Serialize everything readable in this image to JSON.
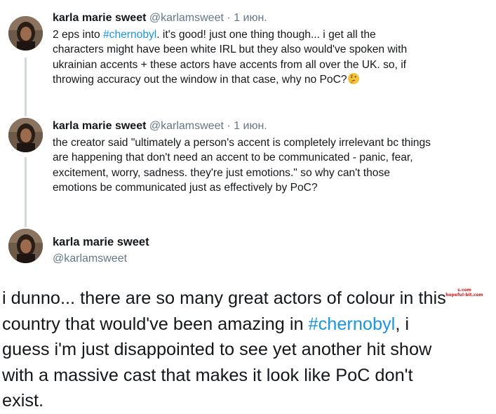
{
  "tweets": [
    {
      "name": "karla marie sweet",
      "handle": "@karlamsweet",
      "separator": "·",
      "date": "1 июн.",
      "text_parts": {
        "l1a": "2 eps into ",
        "hashtag": "#chernobyl",
        "l1b": ". it's good! just one thing though... i get all the",
        "l2": "characters might have been white IRL but they also would've spoken with",
        "l3": "ukrainian accents + these actors have accents from all over the UK. so, if",
        "l4": "throwing accuracy out the window in that case, why no PoC?"
      },
      "emoji": "thinking-face-icon"
    },
    {
      "name": "karla marie sweet",
      "handle": "@karlamsweet",
      "separator": "·",
      "date": "1 июн.",
      "text_lines": [
        "the creator said \"ultimately a person's accent is completely irrelevant bc things",
        "are happening that don't need an accent to be communicated - panic, fear,",
        "excitement, worry, sadness. they're just emotions.\" so why can't those",
        "emotions be communicated just as effectively by PoC?"
      ]
    }
  ],
  "focused_tweet": {
    "name": "karla marie sweet",
    "handle": "@karlamsweet",
    "text_parts": {
      "l1": "i dunno... there are so many great actors of colour in this",
      "l2a": "country that would've been amazing in ",
      "hashtag": "#chernobyl",
      "l2b": ", i",
      "l3": "guess i'm just disappointed to see yet another hit show",
      "l4": "with a massive cast that makes it look like PoC don't",
      "l5": "exist."
    }
  },
  "watermark": {
    "line1": "s.com",
    "line2": "hopeful-bit.com"
  },
  "colors": {
    "hashtag": "#1b95e0",
    "muted": "#657786",
    "text": "#14171a",
    "thread_line": "#d4d9dd"
  }
}
